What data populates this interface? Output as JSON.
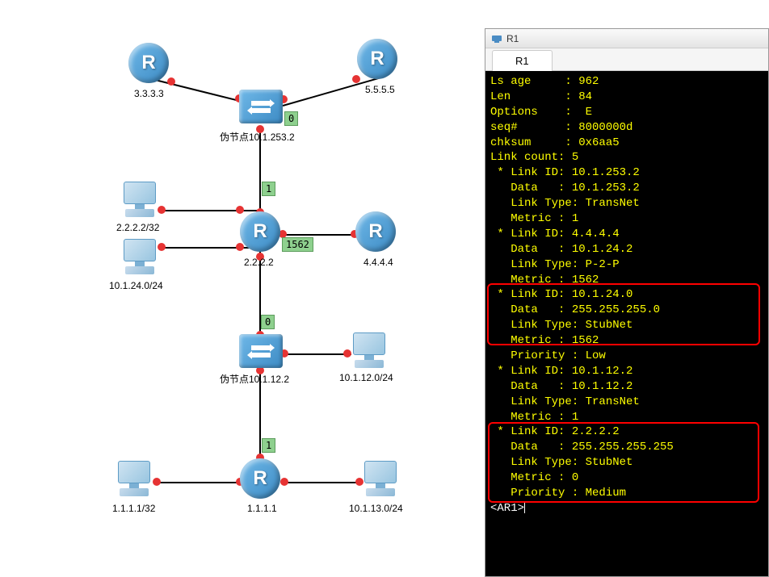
{
  "terminal": {
    "title": "R1",
    "tab": "R1",
    "prompt": "<AR1>",
    "lines": [
      "Ls age     : 962",
      "Len        : 84",
      "Options    :  E",
      "seq#       : 8000000d",
      "chksum     : 0x6aa5",
      "Link count: 5",
      " * Link ID: 10.1.253.2",
      "   Data   : 10.1.253.2",
      "   Link Type: TransNet",
      "   Metric : 1",
      " * Link ID: 4.4.4.4",
      "   Data   : 10.1.24.2",
      "   Link Type: P-2-P",
      "   Metric : 1562",
      " * Link ID: 10.1.24.0",
      "   Data   : 255.255.255.0",
      "   Link Type: StubNet",
      "   Metric : 1562",
      "   Priority : Low",
      " * Link ID: 10.1.12.2",
      "   Data   : 10.1.12.2",
      "   Link Type: TransNet",
      "   Metric : 1",
      " * Link ID: 2.2.2.2",
      "   Data   : 255.255.255.255",
      "   Link Type: StubNet",
      "   Metric : 0",
      "   Priority : Medium"
    ]
  },
  "topology": {
    "routers": {
      "r1": {
        "label": "3.3.3.3"
      },
      "r2": {
        "label": "5.5.5.5"
      },
      "r3": {
        "label": "2.2.2.2",
        "net": "2.2.2.2/32"
      },
      "r4": {
        "label": "4.4.4.4"
      },
      "r5": {
        "label": "1.1.1.1",
        "net": "1.1.1.1/32"
      }
    },
    "switches": {
      "s1": {
        "label": "伪节点10.1.253.2"
      },
      "s2": {
        "label": "伪节点10.1.12.2"
      }
    },
    "pcs": {
      "p1": {
        "label": "10.1.24.0/24"
      },
      "p2": {
        "label": "10.1.12.0/24"
      },
      "p3": {
        "label": "10.1.13.0/24"
      }
    },
    "metrics": {
      "m1": "0",
      "m2": "1",
      "m3": "1562",
      "m4": "0",
      "m5": "1"
    }
  },
  "chart_data": {
    "type": "network-topology",
    "nodes": [
      {
        "id": "3.3.3.3",
        "type": "router"
      },
      {
        "id": "5.5.5.5",
        "type": "router"
      },
      {
        "id": "pseudo-10.1.253.2",
        "type": "switch",
        "label": "伪节点10.1.253.2"
      },
      {
        "id": "2.2.2.2",
        "type": "router",
        "nets": [
          "2.2.2.2/32",
          "10.1.24.0/24"
        ]
      },
      {
        "id": "4.4.4.4",
        "type": "router"
      },
      {
        "id": "pseudo-10.1.12.2",
        "type": "switch",
        "label": "伪节点10.1.12.2",
        "nets": [
          "10.1.12.0/24"
        ]
      },
      {
        "id": "1.1.1.1",
        "type": "router",
        "nets": [
          "1.1.1.1/32",
          "10.1.13.0/24"
        ]
      }
    ],
    "edges": [
      {
        "from": "3.3.3.3",
        "to": "pseudo-10.1.253.2"
      },
      {
        "from": "5.5.5.5",
        "to": "pseudo-10.1.253.2"
      },
      {
        "from": "pseudo-10.1.253.2",
        "to": "2.2.2.2",
        "metric": 1,
        "label_at_switch": 0
      },
      {
        "from": "2.2.2.2",
        "to": "4.4.4.4",
        "metric": 1562
      },
      {
        "from": "2.2.2.2",
        "to": "pseudo-10.1.12.2",
        "label_at_switch": 0
      },
      {
        "from": "pseudo-10.1.12.2",
        "to": "1.1.1.1",
        "metric": 1
      }
    ],
    "lsa": {
      "ls_age": 962,
      "len": 84,
      "options": "E",
      "seq": "8000000d",
      "chksum": "0x6aa5",
      "link_count": 5,
      "links": [
        {
          "id": "10.1.253.2",
          "data": "10.1.253.2",
          "type": "TransNet",
          "metric": 1
        },
        {
          "id": "4.4.4.4",
          "data": "10.1.24.2",
          "type": "P-2-P",
          "metric": 1562
        },
        {
          "id": "10.1.24.0",
          "data": "255.255.255.0",
          "type": "StubNet",
          "metric": 1562,
          "priority": "Low"
        },
        {
          "id": "10.1.12.2",
          "data": "10.1.12.2",
          "type": "TransNet",
          "metric": 1
        },
        {
          "id": "2.2.2.2",
          "data": "255.255.255.255",
          "type": "StubNet",
          "metric": 0,
          "priority": "Medium"
        }
      ]
    }
  }
}
